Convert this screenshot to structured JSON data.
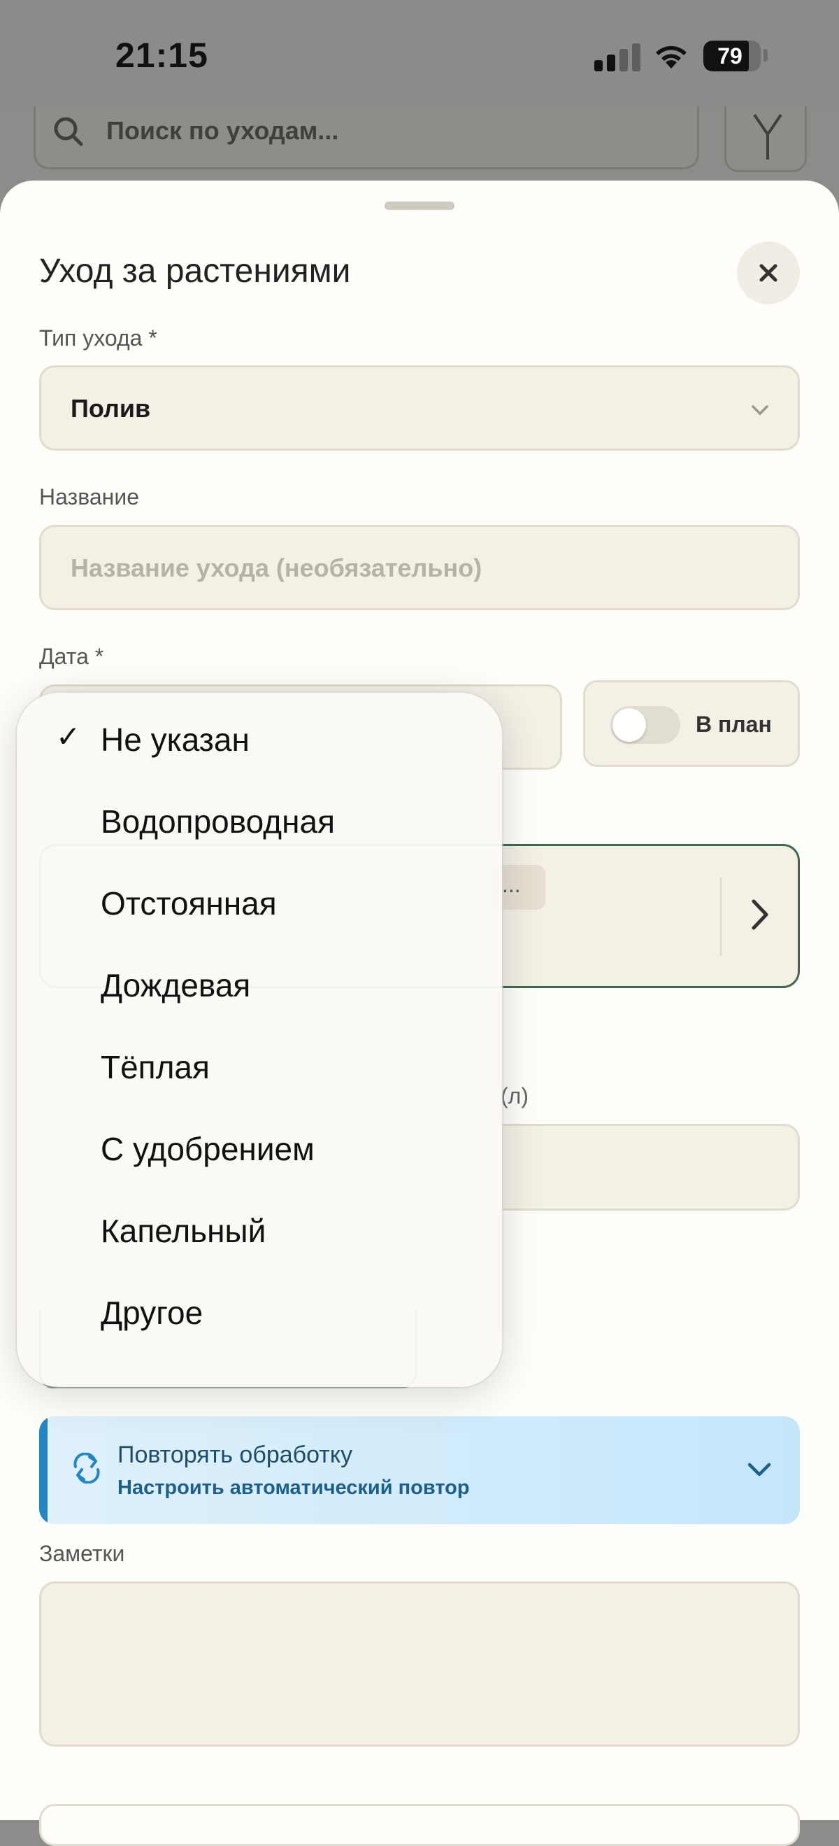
{
  "status_bar": {
    "time": "21:15",
    "battery": "79",
    "battery_level": 0.79
  },
  "background": {
    "search_placeholder": "Поиск по уходам..."
  },
  "sheet": {
    "title": "Уход за растениями",
    "care_type": {
      "label": "Тип ухода *",
      "value": "Полив"
    },
    "name": {
      "label": "Название",
      "placeholder": "Название ухода (необязательно)"
    },
    "date": {
      "label": "Дата *"
    },
    "plan_toggle": {
      "label": "В план",
      "on": false
    },
    "water_chip_text": "...",
    "volume_label_fragment": "(л)",
    "repeat": {
      "title": "Повторять обработку",
      "subtitle": "Настроить автоматический повтор"
    },
    "notes": {
      "label": "Заметки"
    }
  },
  "dropdown": {
    "selected_index": 0,
    "items": [
      {
        "label": "Не указан",
        "checked": true
      },
      {
        "label": "Водопроводная",
        "checked": false
      },
      {
        "label": "Отстоянная",
        "checked": false
      },
      {
        "label": "Дождевая",
        "checked": false
      },
      {
        "label": "Тёплая",
        "checked": false
      },
      {
        "label": "С удобрением",
        "checked": false
      },
      {
        "label": "Капельный",
        "checked": false
      },
      {
        "label": "Другое",
        "checked": false
      }
    ]
  },
  "colors": {
    "accent_green": "#3f6a4e",
    "field_bg": "#f4f0e6",
    "repeat_accent": "#2186c4"
  }
}
